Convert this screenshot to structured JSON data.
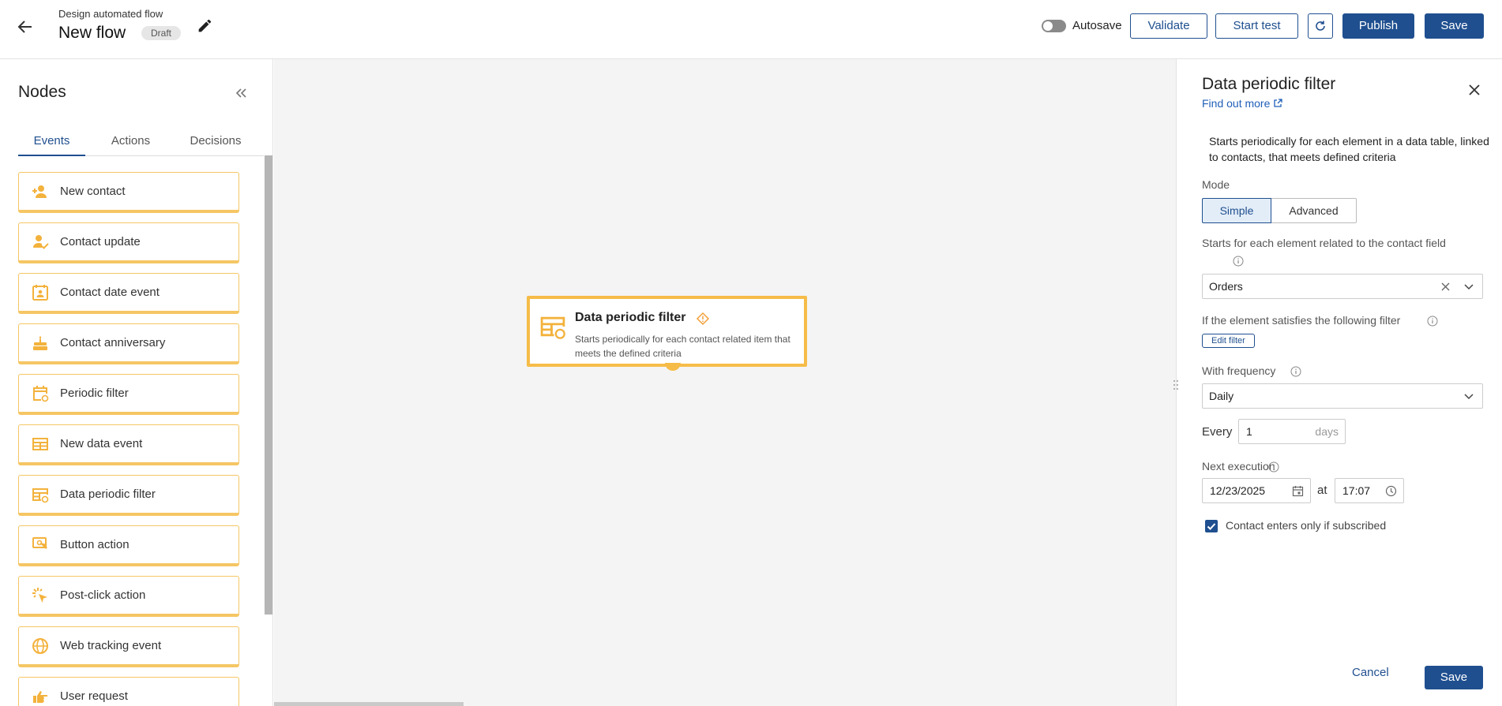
{
  "header": {
    "subtitle": "Design automated flow",
    "title": "New flow",
    "status_badge": "Draft",
    "autosave_label": "Autosave",
    "validate_label": "Validate",
    "start_test_label": "Start test",
    "publish_label": "Publish",
    "save_label": "Save"
  },
  "sidebar": {
    "title": "Nodes",
    "tabs": [
      {
        "label": "Events",
        "active": true
      },
      {
        "label": "Actions",
        "active": false
      },
      {
        "label": "Decisions",
        "active": false
      }
    ],
    "items": [
      {
        "label": "New contact",
        "icon": "add-person-icon"
      },
      {
        "label": "Contact update",
        "icon": "person-check-icon"
      },
      {
        "label": "Contact date event",
        "icon": "calendar-person-icon"
      },
      {
        "label": "Contact anniversary",
        "icon": "cake-icon"
      },
      {
        "label": "Periodic filter",
        "icon": "calendar-refresh-icon"
      },
      {
        "label": "New data event",
        "icon": "table-icon"
      },
      {
        "label": "Data periodic filter",
        "icon": "table-refresh-icon"
      },
      {
        "label": "Button action",
        "icon": "screen-click-icon"
      },
      {
        "label": "Post-click action",
        "icon": "cursor-click-icon"
      },
      {
        "label": "Web tracking event",
        "icon": "globe-icon"
      },
      {
        "label": "User request",
        "icon": "hand-point-icon"
      }
    ]
  },
  "canvas": {
    "node": {
      "title": "Data periodic filter",
      "description": "Starts periodically for each contact related item that meets the defined criteria",
      "icon": "table-refresh-icon",
      "warning_icon": "warning-diamond-icon"
    }
  },
  "panel": {
    "title": "Data periodic filter",
    "find_out_more": "Find out more",
    "description": "Starts periodically for each element in a data table, linked to contacts, that meets defined criteria",
    "mode_label": "Mode",
    "mode_options": [
      "Simple",
      "Advanced"
    ],
    "mode_selected": "Simple",
    "field_label": "Starts for each element related to the contact field",
    "field_value": "Orders",
    "filter_label": "If the element satisfies the following filter",
    "edit_filter_label": "Edit filter",
    "frequency_label": "With frequency",
    "frequency_value": "Daily",
    "every_label": "Every",
    "every_value": "1",
    "every_unit": "days",
    "next_execution_label": "Next execution",
    "date_value": "12/23/2025",
    "at_label": "at",
    "time_value": "17:07",
    "subscribed_label": "Contact enters only if subscribed",
    "subscribed_checked": true,
    "cancel_label": "Cancel",
    "save_label": "Save"
  },
  "colors": {
    "primary": "#1f4f8f",
    "node_accent": "#f5c664",
    "link": "#1f5fb8"
  }
}
